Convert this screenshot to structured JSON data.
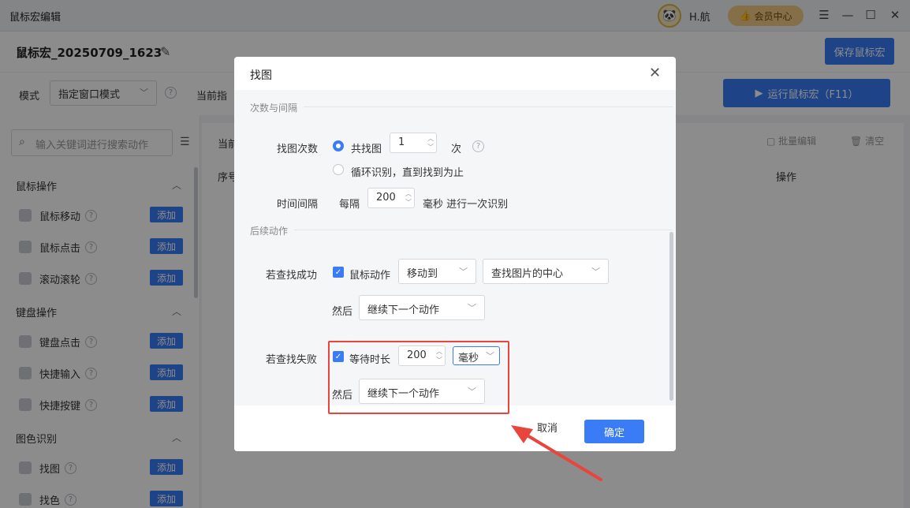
{
  "titlebar": {
    "title": "鼠标宏编辑",
    "username": "H.航",
    "vip_label": "会员中心",
    "avatar_icon": "panda-avatar"
  },
  "toolbar": {
    "macro_name": "鼠标宏_20250709_1623",
    "save_label": "保存鼠标宏",
    "mode_label": "模式",
    "mode_value": "指定窗口模式",
    "current_label": "当前指",
    "run_label": "运行鼠标宏（F11）"
  },
  "sidebar": {
    "search_placeholder": "输入关键词进行搜索动作",
    "groups": [
      {
        "title": "鼠标操作",
        "items": [
          "鼠标移动",
          "鼠标点击",
          "滚动滚轮"
        ]
      },
      {
        "title": "键盘操作",
        "items": [
          "键盘点击",
          "快捷输入",
          "快捷按键"
        ]
      },
      {
        "title": "图色识别",
        "items": [
          "找图",
          "找色"
        ]
      }
    ],
    "add_label": "添加"
  },
  "main": {
    "head_label": "当前",
    "batch_edit": "批量编辑",
    "clear": "清空",
    "col_seq": "序号",
    "col_op": "操作"
  },
  "dialog": {
    "title": "找图",
    "section1": "次数与间隔",
    "find_count_label": "找图次数",
    "opt_total": "共找图",
    "count_value": "1",
    "count_unit": "次",
    "opt_loop": "循环识别，直到找到为止",
    "interval_label": "时间间隔",
    "every": "每隔",
    "interval_value": "200",
    "interval_suffix": "毫秒 进行一次识别",
    "section2": "后续动作",
    "success_label": "若查找成功",
    "mouse_action": "鼠标动作",
    "move_to": "移动到",
    "target": "查找图片的中心",
    "then": "然后",
    "next_action": "继续下一个动作",
    "fail_label": "若查找失败",
    "wait_label": "等待时长",
    "wait_value": "200",
    "wait_unit": "毫秒",
    "cancel": "取消",
    "ok": "确定"
  },
  "colors": {
    "accent": "#3a7bf6",
    "highlight": "#e8453c",
    "vip": "#f3cb83"
  }
}
